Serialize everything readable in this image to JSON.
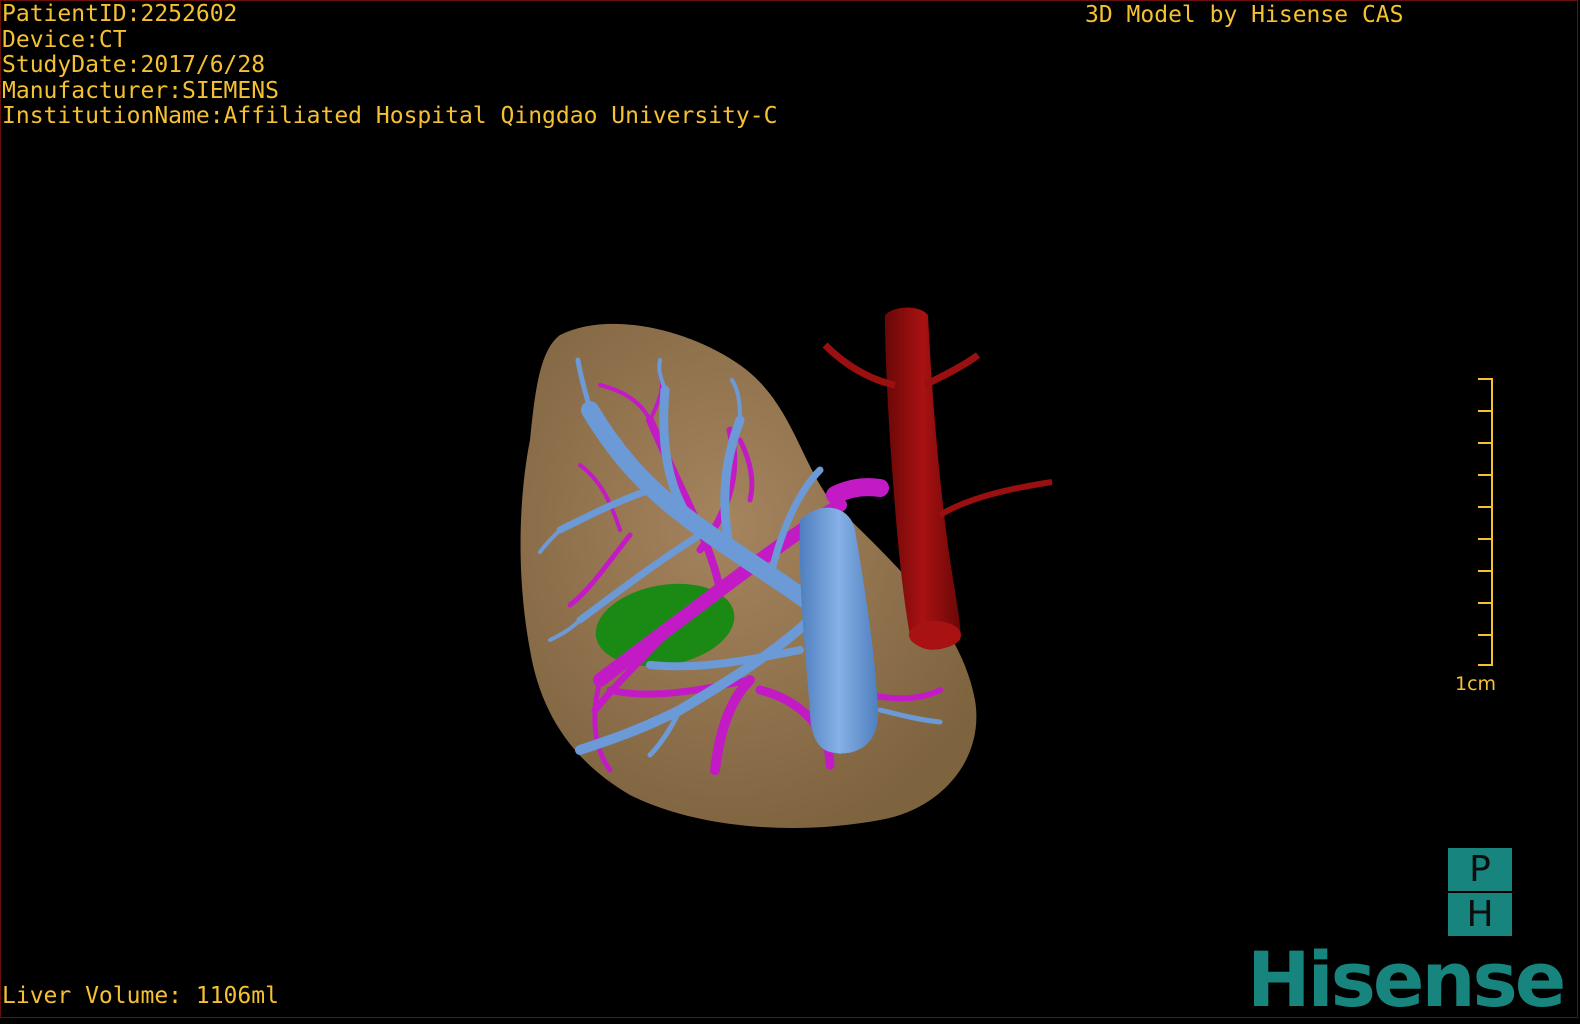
{
  "overlay": {
    "patient_id": "PatientID:2252602",
    "device": "Device:CT",
    "study_date": "StudyDate:2017/6/28",
    "manufacturer": "Manufacturer:SIEMENS",
    "institution": "InstitutionName:Affiliated Hospital Qingdao University-C",
    "model_credit": "3D Model by Hisense CAS",
    "liver_volume": "Liver Volume: 1106ml"
  },
  "scale_bar": {
    "label": "1cm"
  },
  "badge": {
    "top": "P",
    "bottom": "H"
  },
  "logo": {
    "text": "Hisense"
  },
  "colors": {
    "overlay_text": "#f5c032",
    "liver": "#9a7a55",
    "portal_vein": "#6b9ad6",
    "hepatic_vein": "#c21bc6",
    "aorta": "#8e0c0c",
    "gallbladder": "#1a8a14",
    "brand": "#17847e"
  }
}
